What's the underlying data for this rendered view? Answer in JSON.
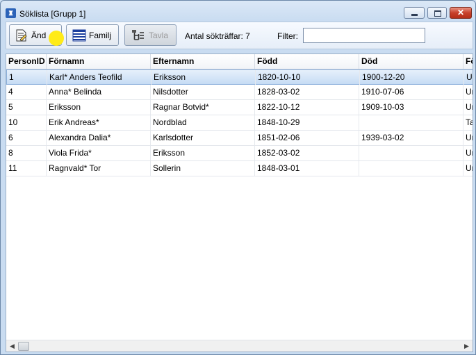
{
  "window": {
    "title": "Söklista [Grupp 1]",
    "app_icon": "family-tree-app-icon",
    "close_glyph": "✕"
  },
  "toolbar": {
    "edit_label": "Änd",
    "family_label": "Familj",
    "board_label": "Tavla",
    "result_count": "Antal sökträffar: 7",
    "filter_label": "Filter:",
    "filter_value": ""
  },
  "table": {
    "columns": [
      "PersonID",
      "Förnamn",
      "Efternamn",
      "Född",
      "Död",
      "Fö"
    ],
    "rows": [
      [
        "1",
        "Karl* Anders Teofild",
        "Eriksson",
        "1820-10-10",
        "1900-12-20",
        "Ur"
      ],
      [
        "4",
        "Anna* Belinda",
        "Nilsdotter",
        "1828-03-02",
        "1910-07-06",
        "Ur"
      ],
      [
        "5",
        "Eriksson",
        "Ragnar Botvid*",
        "1822-10-12",
        "1909-10-03",
        "Ur"
      ],
      [
        "10",
        "Erik Andreas*",
        "Nordblad",
        "1848-10-29",
        "",
        "Ta"
      ],
      [
        "6",
        "Alexandra Dalia*",
        "Karlsdotter",
        "1851-02-06",
        "1939-03-02",
        "Ur"
      ],
      [
        "8",
        "Viola Frida*",
        "Eriksson",
        "1852-03-02",
        "",
        "Ur"
      ],
      [
        "11",
        "Ragnvald* Tor",
        "Sollerin",
        "1848-03-01",
        "",
        "Ur"
      ]
    ],
    "selected_row": 0
  },
  "scrollbar": {
    "left_arrow": "◀",
    "right_arrow": "▶"
  }
}
